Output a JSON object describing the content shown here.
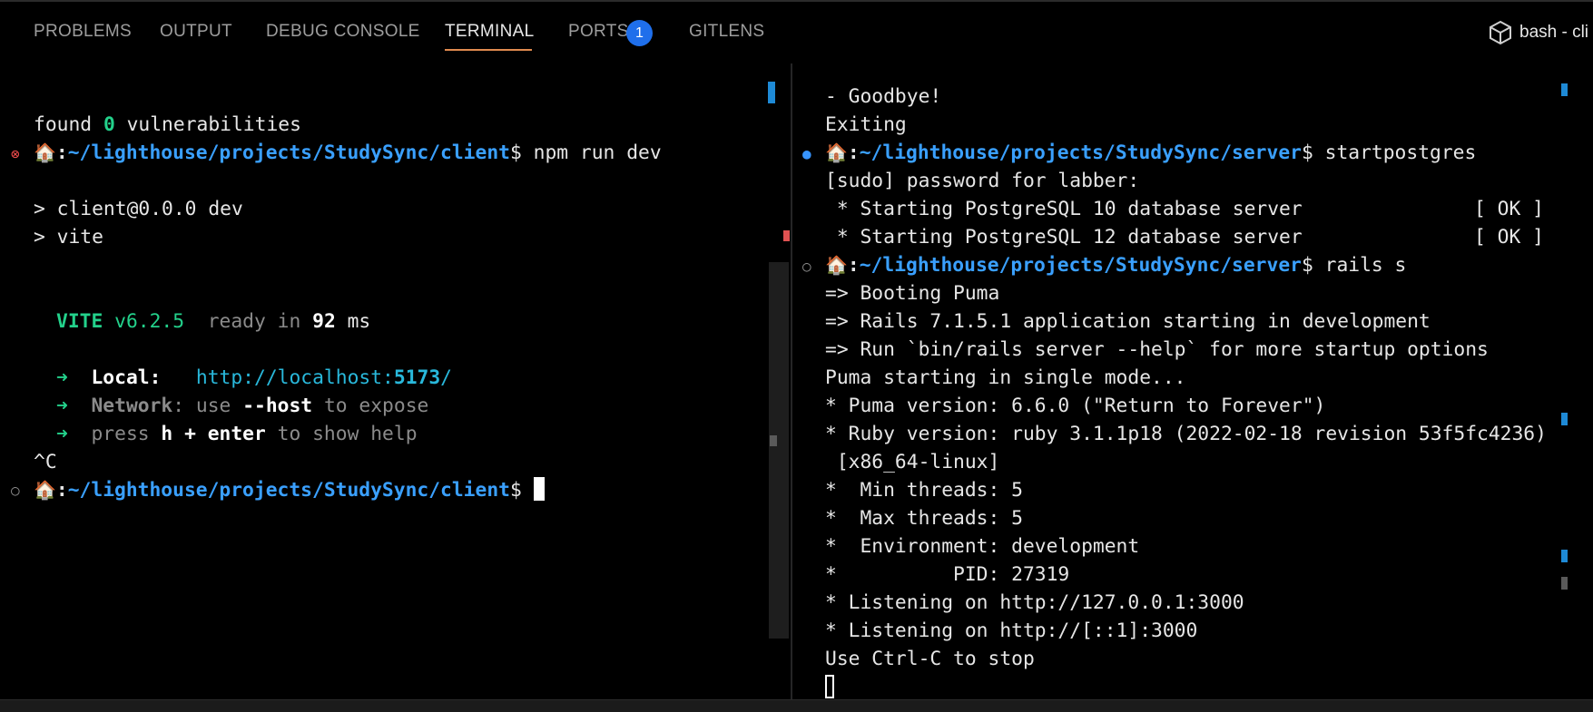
{
  "panel": {
    "tabs": [
      "PROBLEMS",
      "OUTPUT",
      "DEBUG CONSOLE",
      "TERMINAL",
      "PORTS",
      "GITLENS"
    ],
    "active_tab": "TERMINAL",
    "ports_badge": "1",
    "terminal_label": "bash - cli"
  },
  "left_terminal": {
    "line1": {
      "a": "found ",
      "b": "0",
      "c": " vulnerabilities"
    },
    "prompt_path": "~/lighthouse/projects/StudySync/client",
    "prompt_sep": ":",
    "prompt_dollar": "$",
    "cmd1": " npm run dev",
    "out1": "> client@0.0.0 dev",
    "out2": "> vite",
    "vite": {
      "name": "VITE",
      "version": "v6.2.5",
      "ready": "ready in",
      "ms_value": "92",
      "ms_unit": "ms"
    },
    "local": {
      "arrow": "➜",
      "label": "Local:",
      "url_prefix": "http://localhost:",
      "url_port": "5173",
      "url_suffix": "/"
    },
    "network": {
      "arrow": "➜",
      "label": "Network",
      "text1": ": use ",
      "flag": "--host",
      "text2": " to expose"
    },
    "help": {
      "arrow": "➜",
      "text1": "press ",
      "keys": "h + enter",
      "text2": " to show help"
    },
    "ctrl_c": "^C"
  },
  "right_terminal": {
    "lines_top": [
      "- Goodbye!",
      "Exiting"
    ],
    "prompt_path": "~/lighthouse/projects/StudySync/server",
    "prompt_sep": ":",
    "prompt_dollar": "$",
    "cmd1": " startpostgres",
    "sudo": "[sudo] password for labber:",
    "pg10": " * Starting PostgreSQL 10 database server",
    "pg12": " * Starting PostgreSQL 12 database server",
    "ok": "[ OK ]",
    "cmd2": " rails s",
    "rails_out": [
      "=> Booting Puma",
      "=> Rails 7.1.5.1 application starting in development",
      "=> Run `bin/rails server --help` for more startup options",
      "Puma starting in single mode...",
      "* Puma version: 6.6.0 (\"Return to Forever\")",
      "* Ruby version: ruby 3.1.1p18 (2022-02-18 revision 53f5fc4236)",
      " [x86_64-linux]",
      "*  Min threads: 5",
      "*  Max threads: 5",
      "*  Environment: development",
      "*          PID: 27319",
      "* Listening on http://127.0.0.1:3000",
      "* Listening on http://[::1]:3000",
      "Use Ctrl-C to stop"
    ]
  },
  "colors": {
    "background": "#000000",
    "prompt_blue": "#3aa0ff",
    "vite_green": "#23d18b",
    "link_cyan": "#29b8db",
    "active_tab_underline": "#e08a4f",
    "badge_blue": "#1f6feb"
  },
  "icons": {
    "home": "house-emoji",
    "error_decoration": "circle-x-icon",
    "success_decoration": "filled-circle-icon",
    "running_decoration": "hollow-circle-icon",
    "terminal_profile": "cube-icon"
  }
}
